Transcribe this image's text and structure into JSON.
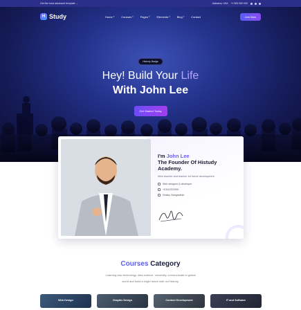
{
  "topbar": {
    "announcement": "Get the most advanced template →",
    "address": "Alabama, USA",
    "phone": "+1 800 000 000"
  },
  "nav": {
    "logo_mark": "H",
    "logo_text": "Study",
    "items": [
      {
        "label": "Home"
      },
      {
        "label": "Courses"
      },
      {
        "label": "Pages"
      },
      {
        "label": "Elements"
      },
      {
        "label": "Blog"
      },
      {
        "label": "Contact"
      }
    ],
    "join_label": "Join Now"
  },
  "hero": {
    "badge": "Histudy Badge",
    "line1_prefix": "Hey! Build Your",
    "line1_accent": "Life",
    "line2": "With John Lee",
    "cta": "Get Started Today"
  },
  "founder": {
    "name_prefix": "I'm",
    "name_accent": "John Lee",
    "role_line1": "The Founder Of Histudy",
    "role_line2": "Academy.",
    "description": "Web teacher and teacher for future development",
    "meta": [
      {
        "icon": "briefcase-icon",
        "text": "Web designer & developer"
      },
      {
        "icon": "phone-icon",
        "text": "+01111222000"
      },
      {
        "icon": "location-icon",
        "text": "Dhaka, Bangladesh"
      }
    ]
  },
  "courses": {
    "title_accent": "Courses",
    "title_rest": "Category",
    "desc_line1": "Learning new technology, data science, university, communicate to global",
    "desc_line2": "world and build a bright future with our histudy.",
    "tiles": [
      {
        "label": "Web Design"
      },
      {
        "label": "Graphic Design"
      },
      {
        "label": "Content Development"
      },
      {
        "label": "IT and Software"
      }
    ]
  },
  "colors": {
    "accent": "#5a5cf5",
    "hero_dark": "#141a54",
    "cta_start": "#6c4cf3",
    "cta_end": "#a23ef0"
  }
}
